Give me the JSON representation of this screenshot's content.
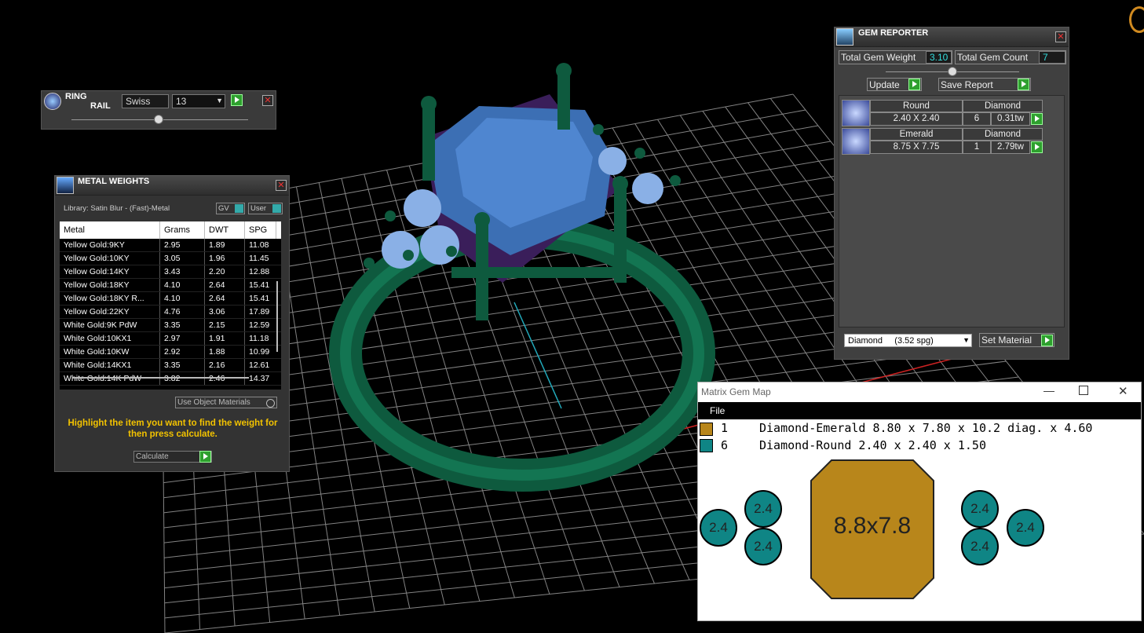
{
  "colors": {
    "emerald_fill": "#b8861b",
    "round_fill": "#0f8585",
    "ring_metal": "#0e5a3e",
    "gem_blue": "#3c6fb4",
    "accent_green": "#2ea02e"
  },
  "ring_rail": {
    "title_line1": "RING",
    "title_line2": "RAIL",
    "profile": "Swiss",
    "size": "13",
    "icon": "ring-rail-icon"
  },
  "metal_weights": {
    "title": "METAL WEIGHTS",
    "library": "Library: Satin Blur - (Fast)-Metal",
    "toggle_gv": "GV",
    "toggle_user": "User",
    "columns": [
      "Metal",
      "Grams",
      "DWT",
      "SPG"
    ],
    "rows": [
      [
        "Yellow Gold:9KY",
        "2.95",
        "1.89",
        "11.08"
      ],
      [
        "Yellow Gold:10KY",
        "3.05",
        "1.96",
        "11.45"
      ],
      [
        "Yellow Gold:14KY",
        "3.43",
        "2.20",
        "12.88"
      ],
      [
        "Yellow Gold:18KY",
        "4.10",
        "2.64",
        "15.41"
      ],
      [
        "Yellow Gold:18KY R...",
        "4.10",
        "2.64",
        "15.41"
      ],
      [
        "Yellow Gold:22KY",
        "4.76",
        "3.06",
        "17.89"
      ],
      [
        "White Gold:9K PdW",
        "3.35",
        "2.15",
        "12.59"
      ],
      [
        "White Gold:10KX1",
        "2.97",
        "1.91",
        "11.18"
      ],
      [
        "White Gold:10KW",
        "2.92",
        "1.88",
        "10.99"
      ],
      [
        "White Gold:14KX1",
        "3.35",
        "2.16",
        "12.61"
      ],
      [
        "White Gold:14K PdW",
        "3.82",
        "2.46",
        "14.37"
      ]
    ],
    "use_object_materials": "Use Object Materials",
    "hint": "Highlight the item you want to find the weight for then press calculate.",
    "calculate": "Calculate"
  },
  "gem_reporter": {
    "title": "GEM REPORTER",
    "total_weight_label": "Total Gem Weight",
    "total_weight": "3.10",
    "total_count_label": "Total Gem Count",
    "total_count": "7",
    "update": "Update",
    "save_report": "Save Report",
    "gems": [
      {
        "shape": "Round",
        "size": "2.40 X 2.40",
        "material": "Diamond",
        "count": "6",
        "weight": "0.31tw"
      },
      {
        "shape": "Emerald",
        "size": "8.75 X 7.75",
        "material": "Diamond",
        "count": "1",
        "weight": "2.79tw"
      }
    ],
    "material_select": "Diamond     (3.52 spg)",
    "set_material": "Set Material"
  },
  "gem_map": {
    "title": "Matrix Gem Map",
    "menu_file": "File",
    "legend": [
      {
        "count": "1",
        "desc": "Diamond-Emerald 8.80 x 7.80 x 10.2 diag. x 4.60"
      },
      {
        "count": "6",
        "desc": "Diamond-Round 2.40 x 2.40 x 1.50"
      }
    ],
    "center_label": "8.8x7.8",
    "round_label": "2.4"
  }
}
